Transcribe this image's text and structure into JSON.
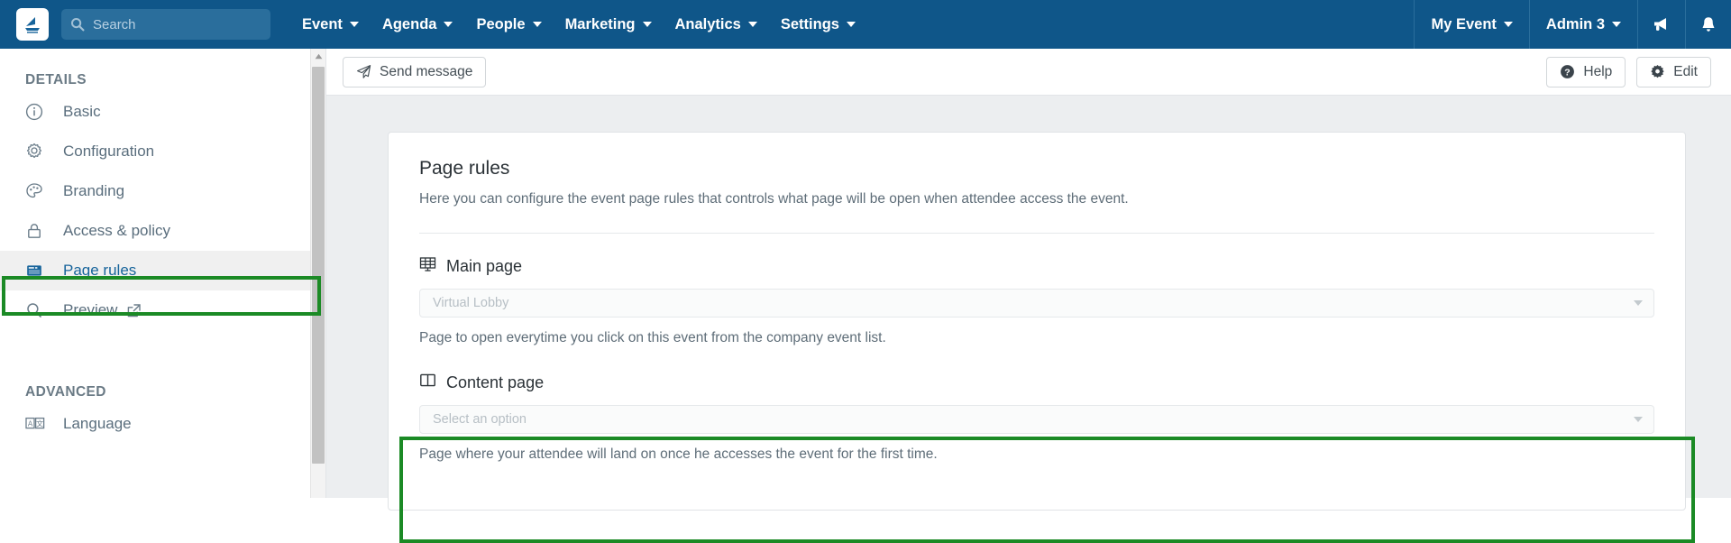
{
  "topnav": {
    "logo_icon": "app-logo-icon",
    "search": {
      "placeholder": "Search",
      "value": "",
      "icon": "search-icon"
    },
    "menus": [
      {
        "label": "Event"
      },
      {
        "label": "Agenda"
      },
      {
        "label": "People"
      },
      {
        "label": "Marketing"
      },
      {
        "label": "Analytics"
      },
      {
        "label": "Settings"
      }
    ],
    "right": [
      {
        "label": "My Event",
        "type": "dropdown"
      },
      {
        "label": "Admin 3",
        "type": "dropdown"
      }
    ],
    "right_icons": [
      {
        "icon": "megaphone-icon"
      },
      {
        "icon": "bell-icon"
      }
    ]
  },
  "sidebar": {
    "sections": [
      {
        "title": "DETAILS",
        "items": [
          {
            "label": "Basic",
            "icon": "info-circle-icon",
            "active": false
          },
          {
            "label": "Configuration",
            "icon": "gear-icon",
            "active": false
          },
          {
            "label": "Branding",
            "icon": "palette-icon",
            "active": false
          },
          {
            "label": "Access & policy",
            "icon": "lock-icon",
            "active": false
          },
          {
            "label": "Page rules",
            "icon": "browser-window-icon",
            "active": true
          },
          {
            "label": "Preview",
            "icon": "magnifier-icon",
            "active": false,
            "external": true
          }
        ]
      },
      {
        "title": "ADVANCED",
        "items": [
          {
            "label": "Language",
            "icon": "translate-icon",
            "active": false
          }
        ]
      }
    ]
  },
  "toolbar": {
    "send_message_label": "Send message",
    "send_message_icon": "paper-plane-icon",
    "help_label": "Help",
    "help_icon": "question-circle-icon",
    "edit_label": "Edit",
    "edit_icon": "gear-icon"
  },
  "main": {
    "card_title": "Page rules",
    "card_subtitle": "Here you can configure the event page rules that controls what page will be open when attendee access the event.",
    "fields": [
      {
        "label": "Main page",
        "icon": "grid-layout-icon",
        "select_value": "Virtual Lobby",
        "help": "Page to open everytime you click on this event from the company event list.",
        "highlighted": false
      },
      {
        "label": "Content page",
        "icon": "two-column-layout-icon",
        "select_value": "Select an option",
        "help": "Page where your attendee will land on once he accesses the event for the first time.",
        "highlighted": true
      }
    ]
  },
  "colors": {
    "nav_blue": "#0f5689",
    "highlight_green": "#1b8a25",
    "active_link_blue": "#17649b",
    "page_bg": "#eceef0"
  }
}
